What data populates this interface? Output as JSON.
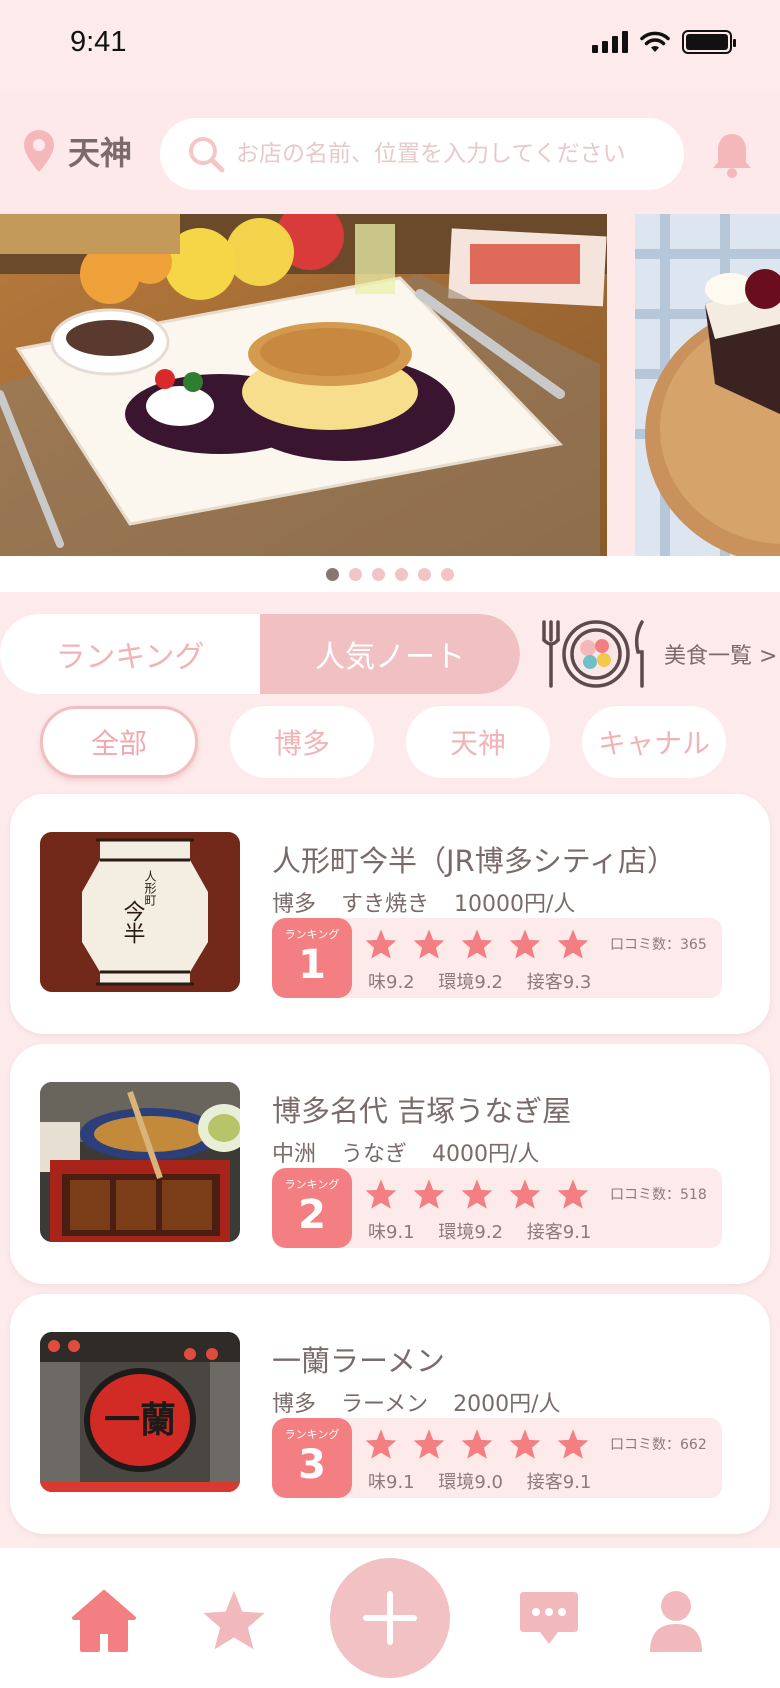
{
  "status_bar": {
    "time": "9:41"
  },
  "header": {
    "location": "天神",
    "search_placeholder": "お店の名前、位置を入力してください"
  },
  "banner": {
    "slide_count": 6,
    "active_index": 0
  },
  "tabs": [
    {
      "label": "ランキング",
      "active": false
    },
    {
      "label": "人気ノート",
      "active": true
    }
  ],
  "food_list_link": "美食一覧 >",
  "filters": [
    {
      "label": "全部",
      "active": true
    },
    {
      "label": "博多",
      "active": false
    },
    {
      "label": "天神",
      "active": false
    },
    {
      "label": "キャナル",
      "active": false
    }
  ],
  "ranking_label": "ランキング",
  "restaurants": [
    {
      "name": "人形町今半（JR博多シティ店）",
      "area": "博多",
      "genre": "すき焼き",
      "price": "10000円/人",
      "rank": "1",
      "stars": 5,
      "reviews": "口コミ数：365",
      "taste": "味9.2",
      "environment": "環境9.2",
      "service": "接客9.3"
    },
    {
      "name": "博多名代 吉塚うなぎ屋",
      "area": "中洲",
      "genre": "うなぎ",
      "price": "4000円/人",
      "rank": "2",
      "stars": 5,
      "reviews": "口コミ数：518",
      "taste": "味9.1",
      "environment": "環境9.2",
      "service": "接客9.1"
    },
    {
      "name": "一蘭ラーメン",
      "area": "博多",
      "genre": "ラーメン",
      "price": "2000円/人",
      "rank": "3",
      "stars": 5,
      "reviews": "口コミ数：662",
      "taste": "味9.1",
      "environment": "環境9.0",
      "service": "接客9.1"
    }
  ],
  "image_text": {
    "lantern": [
      "人形町",
      "今半"
    ],
    "ramen_sign": "一蘭"
  },
  "colors": {
    "background": "#fdebec",
    "accent": "#f47f82",
    "soft_pink": "#f1c0c2",
    "text": "#7a6b6a"
  }
}
